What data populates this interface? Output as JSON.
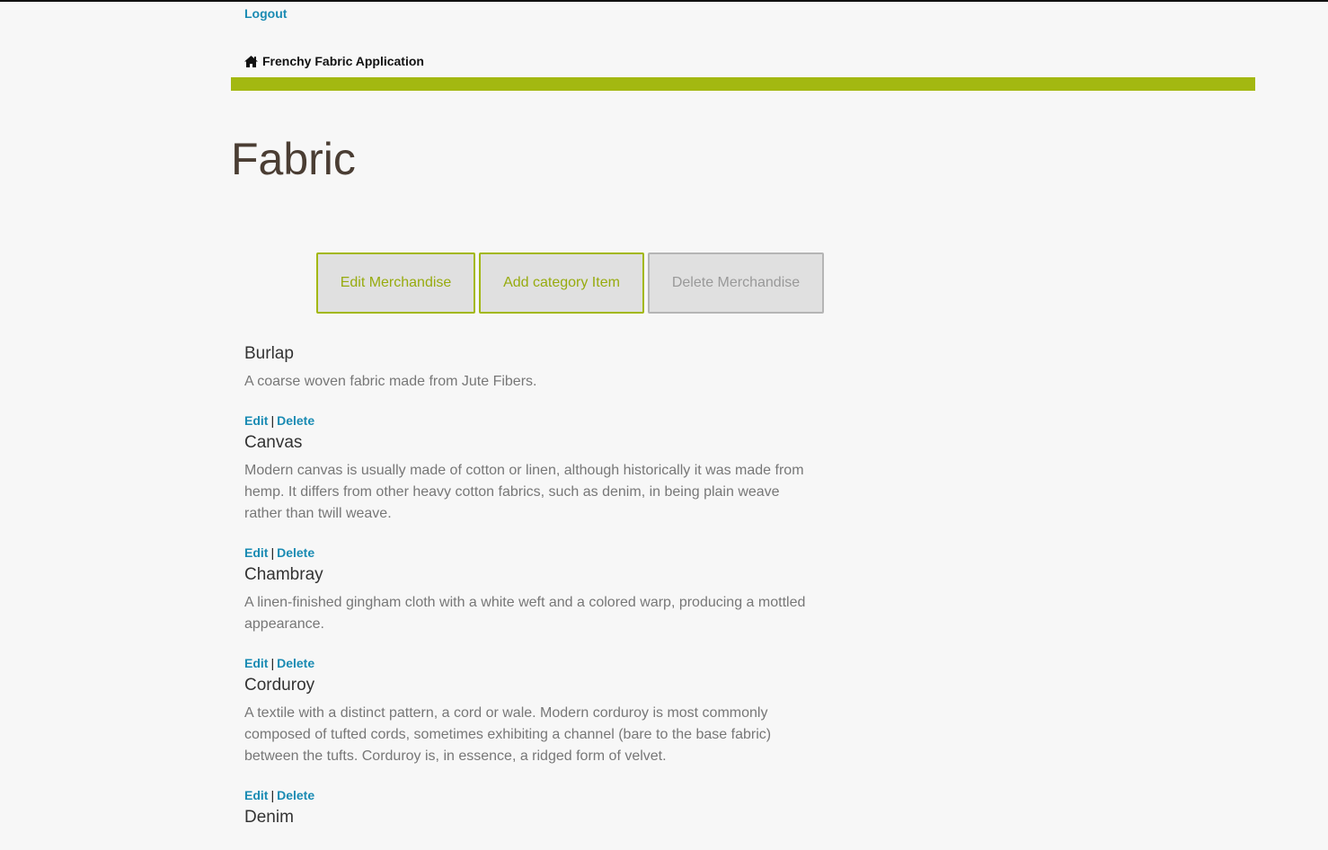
{
  "header": {
    "logout_label": "Logout",
    "brand_title": "Frenchy Fabric Application",
    "brand_icon": "home-icon",
    "accent_color": "#a3b811"
  },
  "page": {
    "title": "Fabric"
  },
  "toolbar": {
    "edit_label": "Edit Merchandise",
    "add_label": "Add category Item",
    "delete_label": "Delete Merchandise"
  },
  "item_actions": {
    "edit_label": "Edit",
    "separator": "|",
    "delete_label": "Delete"
  },
  "items": [
    {
      "name": "Burlap",
      "description": "A coarse woven fabric made from Jute Fibers."
    },
    {
      "name": "Canvas",
      "description": "Modern canvas is usually made of cotton or linen, although historically it was made from hemp. It differs from other heavy cotton fabrics, such as denim, in being plain weave rather than twill weave."
    },
    {
      "name": "Chambray",
      "description": "A linen-finished gingham cloth with a white weft and a colored warp, producing a mottled appearance."
    },
    {
      "name": "Corduroy",
      "description": "A textile with a distinct pattern, a cord or wale. Modern corduroy is most commonly composed of tufted cords, sometimes exhibiting a channel (bare to the base fabric) between the tufts. Corduroy is, in essence, a ridged form of velvet."
    },
    {
      "name": "Denim",
      "description": ""
    }
  ]
}
